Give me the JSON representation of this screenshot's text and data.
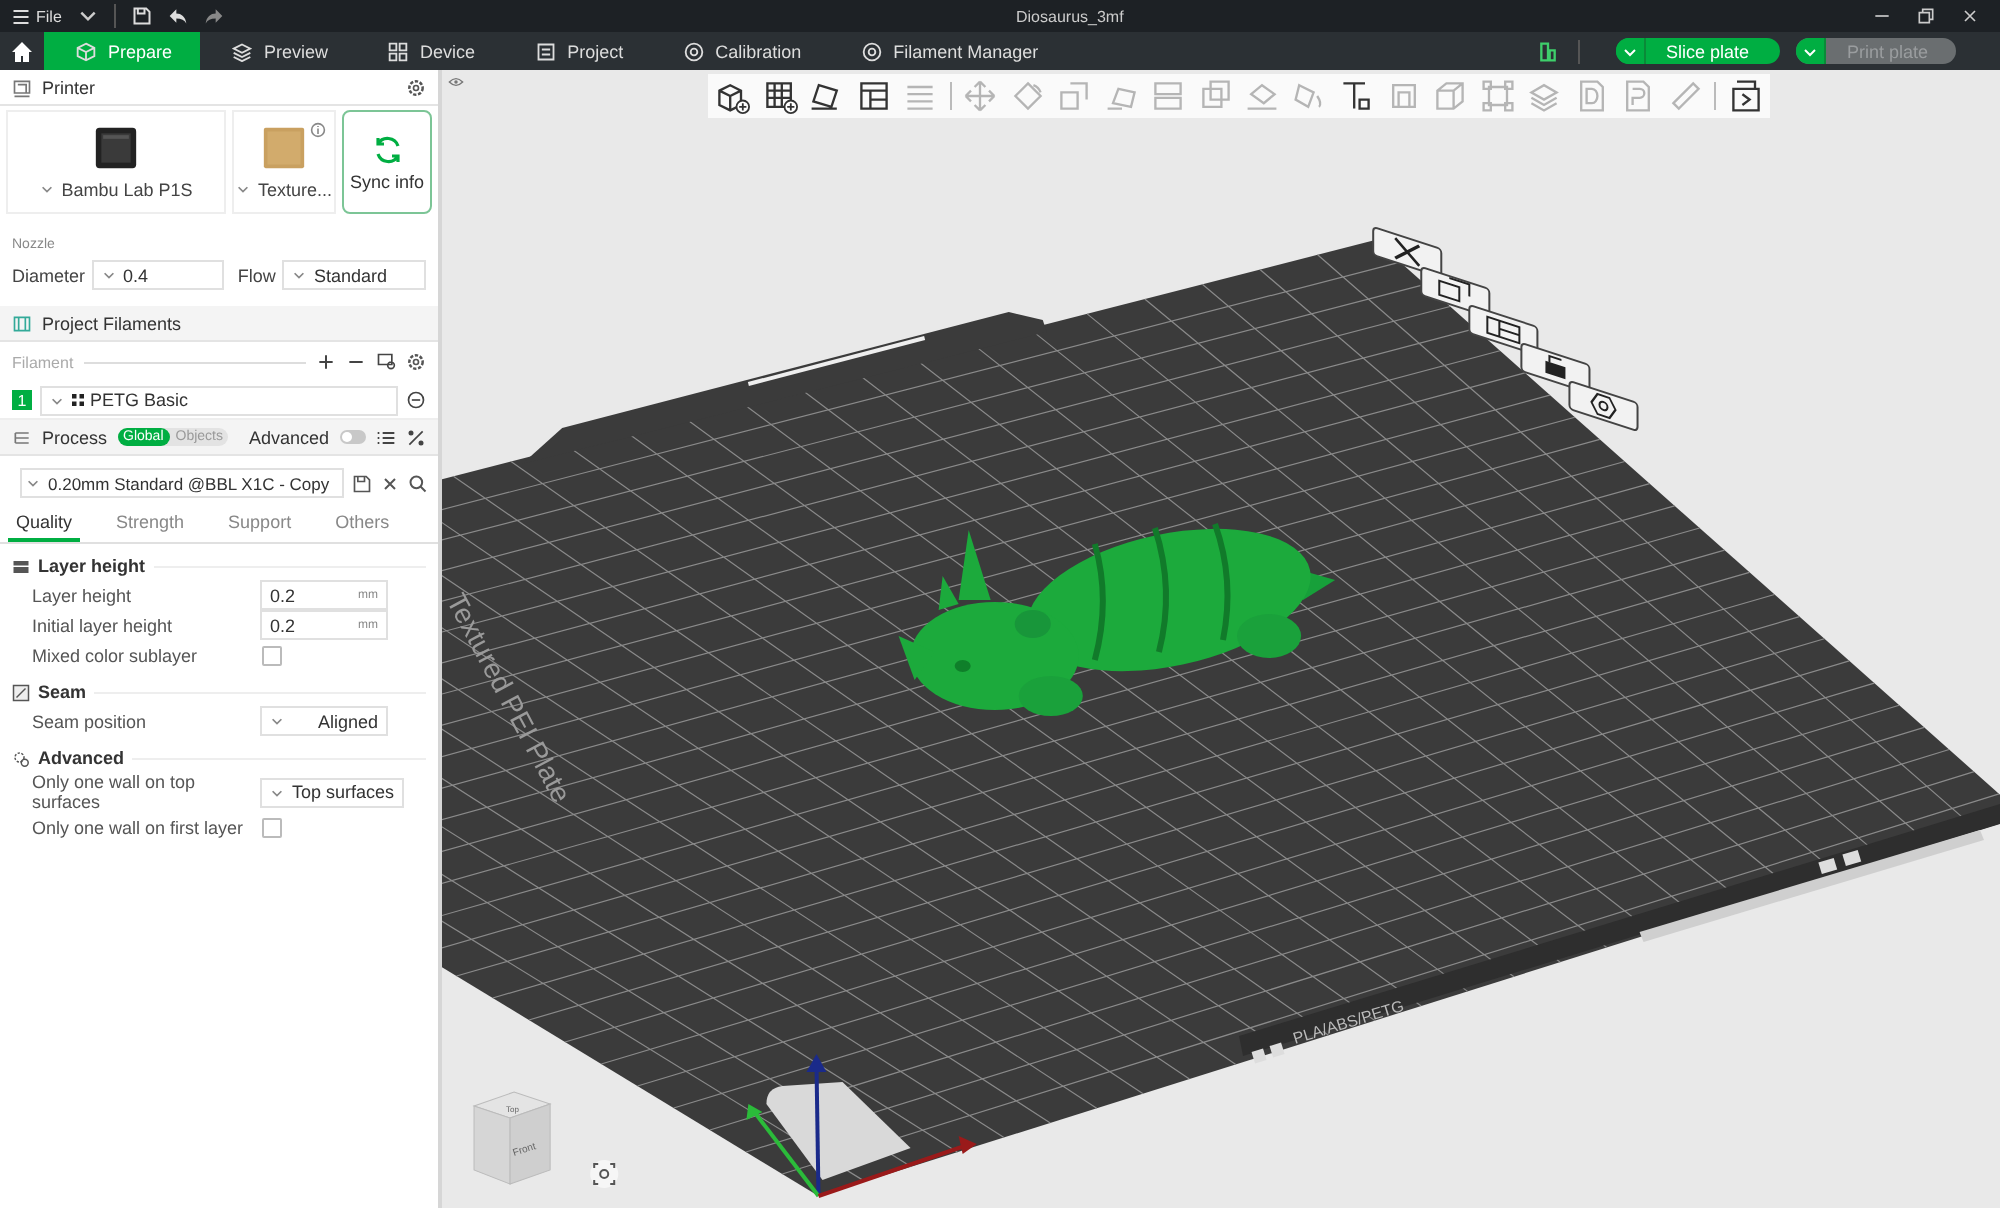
{
  "window": {
    "menu": "File",
    "title": "Diosaurus_3mf"
  },
  "tabs": [
    {
      "label": "Prepare",
      "selected": true
    },
    {
      "label": "Preview",
      "selected": false
    },
    {
      "label": "Device",
      "selected": false
    },
    {
      "label": "Project",
      "selected": false
    },
    {
      "label": "Calibration",
      "selected": false
    },
    {
      "label": "Filament Manager",
      "selected": false
    }
  ],
  "actions": {
    "slice": {
      "label": "Slice plate",
      "disabled": false
    },
    "print": {
      "label": "Print plate",
      "disabled": true
    }
  },
  "printer": {
    "title": "Printer",
    "model": "Bambu Lab P1S",
    "plate": "Texture...",
    "sync": "Sync info",
    "nozzle_label": "Nozzle",
    "diameter_label": "Diameter",
    "diameter": "0.4",
    "flow_label": "Flow",
    "flow": "Standard"
  },
  "filaments": {
    "title": "Project Filaments",
    "label": "Filament",
    "items": [
      {
        "index": "1",
        "name": "PETG Basic",
        "color": "#00ae42"
      }
    ]
  },
  "process": {
    "title": "Process",
    "scopes": [
      {
        "label": "Global",
        "selected": true
      },
      {
        "label": "Objects",
        "selected": false
      }
    ],
    "advanced_label": "Advanced",
    "advanced": false,
    "preset": "0.20mm Standard @BBL X1C - Copy",
    "tabs": [
      {
        "label": "Quality",
        "selected": true
      },
      {
        "label": "Strength",
        "selected": false
      },
      {
        "label": "Support",
        "selected": false
      },
      {
        "label": "Others",
        "selected": false
      }
    ],
    "groups": [
      {
        "title": "Layer height",
        "kind": "layers",
        "rows": [
          {
            "kind": "number",
            "label": "Layer height",
            "value": "0.2",
            "unit": "mm"
          },
          {
            "kind": "number",
            "label": "Initial layer height",
            "value": "0.2",
            "unit": "mm"
          },
          {
            "kind": "checkbox",
            "label": "Mixed color sublayer",
            "checked": false
          }
        ]
      },
      {
        "title": "Seam",
        "kind": "seam",
        "rows": [
          {
            "kind": "select",
            "label": "Seam position",
            "value": "Aligned"
          }
        ]
      },
      {
        "title": "Advanced",
        "kind": "advanced",
        "rows": [
          {
            "kind": "select",
            "label": "Only one wall on top surfaces",
            "value": "Top surfaces"
          },
          {
            "kind": "checkbox",
            "label": "Only one wall on first layer",
            "checked": false
          }
        ]
      }
    ]
  },
  "plate": {
    "name": "Textured PEI Plate",
    "materials": "PLA/ABS/PETG"
  },
  "view_cube": {
    "top": "Top",
    "front": "Front"
  }
}
